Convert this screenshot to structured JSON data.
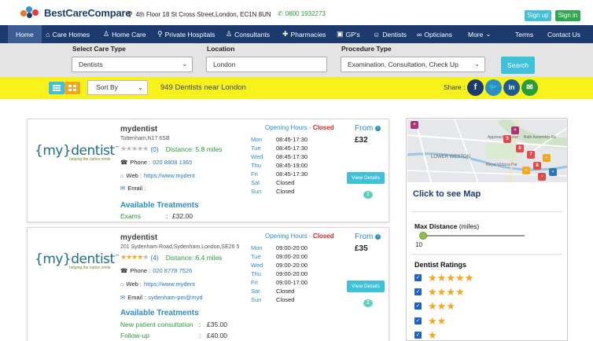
{
  "brand": {
    "name": "BestCareCompare"
  },
  "header": {
    "address": "4th Floor 18 St Cross Street,London, EC1N 8UN",
    "phone": "0800 1932273",
    "signup": "Sign up",
    "signin": "Sign in"
  },
  "nav": {
    "home": "Home",
    "care_homes": "Care Homes",
    "home_care": "Home Care",
    "private_hospitals": "Private Hospitals",
    "consultants": "Consultants",
    "pharmacies": "Pharmacies",
    "gps": "GP's",
    "dentists": "Dentists",
    "opticians": "Opticians",
    "more": "More",
    "terms": "Terms",
    "contact": "Contact Us"
  },
  "search": {
    "care_type_label": "Select Care Type",
    "care_type_value": "Dentists",
    "location_label": "Location",
    "location_value": "London",
    "procedure_label": "Procedure Type",
    "procedure_value": "Examination, Consultation, Check Up",
    "button": "Search"
  },
  "results_bar": {
    "sort_by": "Sort By",
    "count_text": "949 Dentists near London",
    "share_label": "Share :"
  },
  "listings": [
    {
      "logo_main": "{my}dentist",
      "logo_tm": "™",
      "logo_tag": "helping the nation smile",
      "name": "mydentist",
      "address": "Tottenham,N17 6SB",
      "stars": "★★★★★",
      "rating_count": "(0)",
      "distance": "Distance: 5.8 miles",
      "phone_label": "Phone :",
      "phone": "020 8808 1365",
      "web_label": "Web :",
      "web": "https://www.mydent",
      "email_label": "Email :",
      "email": "",
      "oh_label": "Opening Hours - ",
      "oh_status": "Closed",
      "hours": [
        {
          "day": "Mon",
          "time": "08:45-17:30"
        },
        {
          "day": "Tue",
          "time": "08:45-17:30"
        },
        {
          "day": "Wed",
          "time": "08:45-17:30"
        },
        {
          "day": "Thu",
          "time": "08:45-19:00"
        },
        {
          "day": "Fri",
          "time": "08:45-17:30"
        },
        {
          "day": "Sat",
          "time": "Closed"
        },
        {
          "day": "Sun",
          "time": "Closed"
        }
      ],
      "from_label": "From",
      "price": "£32",
      "view_details": "View Details",
      "badge": "1",
      "available_label": "Available Treatments",
      "treatments": [
        {
          "name": "Exams",
          "sep": ":",
          "price": "£32.00"
        }
      ]
    },
    {
      "logo_main": "{my}dentist",
      "logo_tm": "™",
      "logo_tag": "helping the nation smile",
      "name": "mydentist",
      "address": "201 Sydenham Road,Sydenham,London,SE26 5",
      "stars": "★★★★★",
      "rating_count": "(4)",
      "distance": "Distance: 6.4 miles",
      "phone_label": "Phone :",
      "phone": "020 8778 7526",
      "web_label": "Web :",
      "web": "https://www.mydent",
      "email_label": "Email :",
      "email": "sydenham-pm@myd",
      "oh_label": "Opening Hours - ",
      "oh_status": "Closed",
      "hours": [
        {
          "day": "Mon",
          "time": "09:00-20:00"
        },
        {
          "day": "Tue",
          "time": "09:00-20:00"
        },
        {
          "day": "Wed",
          "time": "09:00-20:00"
        },
        {
          "day": "Thu",
          "time": "09:00-20:00"
        },
        {
          "day": "Fri",
          "time": "09:00-17:00"
        },
        {
          "day": "Sat",
          "time": "Closed"
        },
        {
          "day": "Sun",
          "time": "Closed"
        }
      ],
      "from_label": "From",
      "price": "£35",
      "view_details": "View Details",
      "badge": "2",
      "available_label": "Available Treatments",
      "treatments": [
        {
          "name": "New patient consultation",
          "sep": ":",
          "price": "£35.00"
        },
        {
          "name": "Follow-up",
          "sep": ":",
          "price": "£40.00"
        }
      ]
    }
  ],
  "sidebar": {
    "map_labels": {
      "weston": "LOWER WESTON",
      "bath": "Bath Assembly Ro",
      "royal": "Royal Victoria Par",
      "approach": "Approach Course"
    },
    "see_map": "Click to see Map",
    "max_distance_label": "Max Distance",
    "max_distance_unit": " (miles)",
    "max_distance_value": "10",
    "ratings_title": "Dentist Ratings",
    "ratings": [
      "★★★★★",
      "★★★★",
      "★★★",
      "★★",
      "★"
    ]
  },
  "colors": {
    "nav_bg": "#1d3a6e",
    "accent": "#41c0d9",
    "yellow_bar": "#f7f21d",
    "green": "#2b9c3a",
    "closed": "#e02020",
    "star": "#f5a623"
  }
}
